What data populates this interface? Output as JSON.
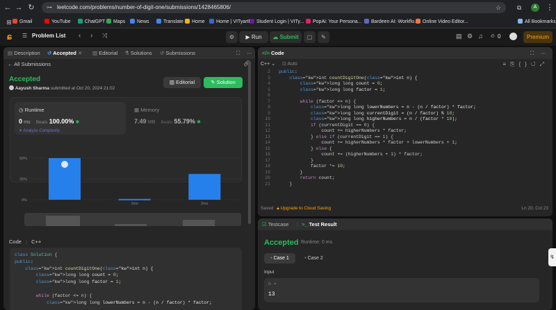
{
  "browser": {
    "url": "leetcode.com/problems/number-of-digit-one/submissions/1428465806/",
    "bookmarks": [
      {
        "label": "Gmail",
        "color": "#ea4335"
      },
      {
        "label": "YouTube",
        "color": "#ff0000"
      },
      {
        "label": "ChatGPT",
        "color": "#10a37f"
      },
      {
        "label": "Maps",
        "color": "#34a853"
      },
      {
        "label": "News",
        "color": "#4285f4"
      },
      {
        "label": "Translate",
        "color": "#4285f4"
      },
      {
        "label": "Home",
        "color": "#f4b400"
      },
      {
        "label": "Home | VITyarthi",
        "color": "#3367d6"
      },
      {
        "label": "Student Login | VITy...",
        "color": "#6a1b9a"
      },
      {
        "label": "PopAi: Your Persona...",
        "color": "#e91e63"
      },
      {
        "label": "Bardeen AI: Workflo...",
        "color": "#5c6bc0"
      },
      {
        "label": "Online Video Editor...",
        "color": "#ff7043"
      }
    ],
    "all_bookmarks": "All Bookmarks",
    "profile_initial": "A"
  },
  "lc": {
    "problem_list": "Problem List",
    "run": "Run",
    "submit": "Submit",
    "streak": "0",
    "premium": "Premium"
  },
  "left": {
    "tabs": {
      "description": "Description",
      "accepted": "Accepted",
      "editorial": "Editorial",
      "solutions": "Solutions",
      "submissions": "Submissions"
    },
    "all_submissions": "All Submissions",
    "status": "Accepted",
    "user": "Aayush Sharma",
    "submitted_at": "submitted at Oct 20, 2024 21:02",
    "editorial_btn": "Editorial",
    "solution_btn": "Solution",
    "runtime_label": "Runtime",
    "runtime_value": "0",
    "runtime_unit": "ms",
    "runtime_beats_label": "Beats",
    "runtime_beats": "100.00%",
    "analyze": "Analyze Complexity",
    "memory_label": "Memory",
    "memory_value": "7.49",
    "memory_unit": "MB",
    "memory_beats_label": "Beats",
    "memory_beats": "55.79%",
    "code_label": "Code",
    "code_lang": "C++"
  },
  "chart_data": {
    "type": "bar",
    "categories": [
      "0ms",
      "1ms",
      "2ms"
    ],
    "values": [
      50,
      1,
      31
    ],
    "ylabel_ticks": [
      "50%",
      "25%",
      "0%"
    ],
    "ylim": [
      0,
      60
    ],
    "highlight": "0ms",
    "bar_color": "#2680eb"
  },
  "editor": {
    "title": "Code",
    "lang": "C++",
    "mode": "Auto",
    "saved": "Saved",
    "upgrade": "Upgrade to Cloud Saving",
    "cursor": "Ln 20, Col 23",
    "first_line": 2,
    "lines": [
      "public:",
      "    int countDigitOne(int n) {",
      "        long long count = 0;",
      "        long long factor = 1;",
      "",
      "        while (factor <= n) {",
      "            long long lowerNumbers = n - (n / factor) * factor;",
      "            long long currentDigit = (n / factor) % 10;",
      "            long long higherNumbers = n / (factor * 10);",
      "            if (currentDigit == 0) {",
      "                count += higherNumbers * factor;",
      "            } else if (currentDigit == 1) {",
      "                count += higherNumbers * factor + lowerNumbers + 1;",
      "            } else {",
      "                count += (higherNumbers + 1) * factor;",
      "            }",
      "            factor *= 10;",
      "        }",
      "        return count;",
      "    }"
    ]
  },
  "left_code": [
    "class Solution {",
    "public:",
    "    int countDigitOne(int n) {",
    "        long long count = 0;",
    "        long long factor = 1;",
    "",
    "        while (factor <= n) {",
    "            long long lowerNumbers = n - (n / factor) * factor;"
  ],
  "result": {
    "testcase_tab": "Testcase",
    "result_tab": "Test Result",
    "status": "Accepted",
    "runtime": "Runtime: 0 ms",
    "case1": "Case 1",
    "case2": "Case 2",
    "input_label": "Input",
    "var": "n =",
    "value": "13"
  }
}
